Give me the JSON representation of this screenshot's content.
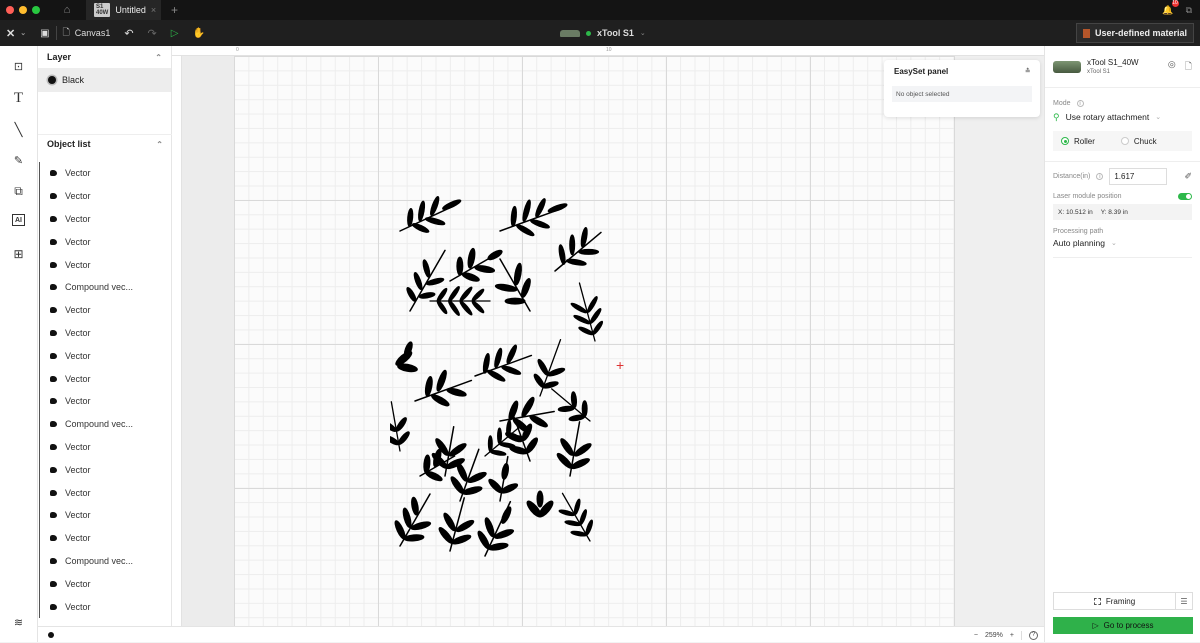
{
  "titlebar": {
    "traffic_colors": [
      "#ff5f57",
      "#febc2e",
      "#28c840"
    ],
    "tab_badge": "S1 40W",
    "tab_title": "Untitled",
    "tab_close": "×",
    "new_tab": "+",
    "notification_count": "10"
  },
  "toolbar": {
    "logo": "✕",
    "logo_chevron": "⌄",
    "canvas_name": "Canvas1",
    "device_name": "xTool S1",
    "device_chevron": "⌄",
    "material_label": "User-defined material"
  },
  "left_tools": [
    {
      "name": "image-icon",
      "glyph": "🖼"
    },
    {
      "name": "text-icon",
      "glyph": "T"
    },
    {
      "name": "line-icon",
      "glyph": "╲"
    },
    {
      "name": "pen-icon",
      "glyph": "✎"
    },
    {
      "name": "shapes-icon",
      "glyph": "⧉"
    },
    {
      "name": "ai-icon",
      "glyph": "AI"
    },
    {
      "name": "apps-icon",
      "glyph": "⊞"
    }
  ],
  "layer_panel": {
    "title": "Layer",
    "chevron": "⌃",
    "layers": [
      {
        "name": "Black",
        "color": "#111111"
      }
    ]
  },
  "object_list": {
    "title": "Object list",
    "chevron": "⌃",
    "items": [
      "Vector",
      "Vector",
      "Vector",
      "Vector",
      "Vector",
      "Compound vec...",
      "Vector",
      "Vector",
      "Vector",
      "Vector",
      "Vector",
      "Compound vec...",
      "Vector",
      "Vector",
      "Vector",
      "Vector",
      "Vector",
      "Compound vec...",
      "Vector",
      "Vector"
    ]
  },
  "canvas": {
    "ruler_labels": [
      "0",
      "10"
    ],
    "zoom_level": "259%",
    "zoom_out": "−",
    "zoom_in": "+",
    "help": "?"
  },
  "easyset": {
    "title": "EasySet panel",
    "empty_text": "No object selected"
  },
  "right_panel": {
    "machine_name": "xTool S1_40W",
    "machine_sub": "xTool S1",
    "mode_label": "Mode",
    "mode_value": "Use rotary attachment",
    "radio_roller": "Roller",
    "radio_chuck": "Chuck",
    "radio_selected": "Roller",
    "distance_label": "Distance(in)",
    "distance_value": "1.617",
    "laser_pos_label": "Laser module position",
    "laser_pos_enabled": true,
    "pos_x": "X: 10.512 in",
    "pos_y": "Y: 8.39 in",
    "path_label": "Processing path",
    "path_value": "Auto planning",
    "framing_label": "Framing",
    "process_label": "Go to process",
    "accent_color": "#2fb14a"
  }
}
